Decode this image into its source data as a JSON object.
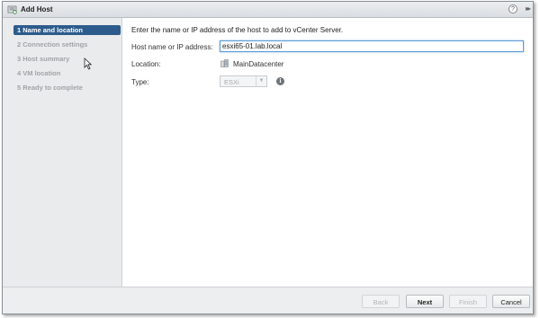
{
  "window": {
    "title": "Add Host",
    "help_label": "?",
    "expand_label": "▸▸"
  },
  "sidebar": {
    "steps": [
      {
        "label": "1  Name and location",
        "active": true
      },
      {
        "label": "2  Connection settings",
        "active": false
      },
      {
        "label": "3  Host summary",
        "active": false
      },
      {
        "label": "4  VM location",
        "active": false
      },
      {
        "label": "5  Ready to complete",
        "active": false
      }
    ]
  },
  "form": {
    "instruction": "Enter the name or IP address of the host to add to vCenter Server.",
    "host_label": "Host name or IP address:",
    "host_value": "esxi65-01.lab.local",
    "location_label": "Location:",
    "location_value": "MainDatacenter",
    "location_icon": "datacenter-icon",
    "type_label": "Type:",
    "type_value": "ESXi",
    "info_icon": "info-icon"
  },
  "footer": {
    "back_label": "Back",
    "next_label": "Next",
    "finish_label": "Finish",
    "cancel_label": "Cancel"
  },
  "colors": {
    "active_step": "#2d5c8c",
    "input_focus": "#5b9bd5"
  }
}
